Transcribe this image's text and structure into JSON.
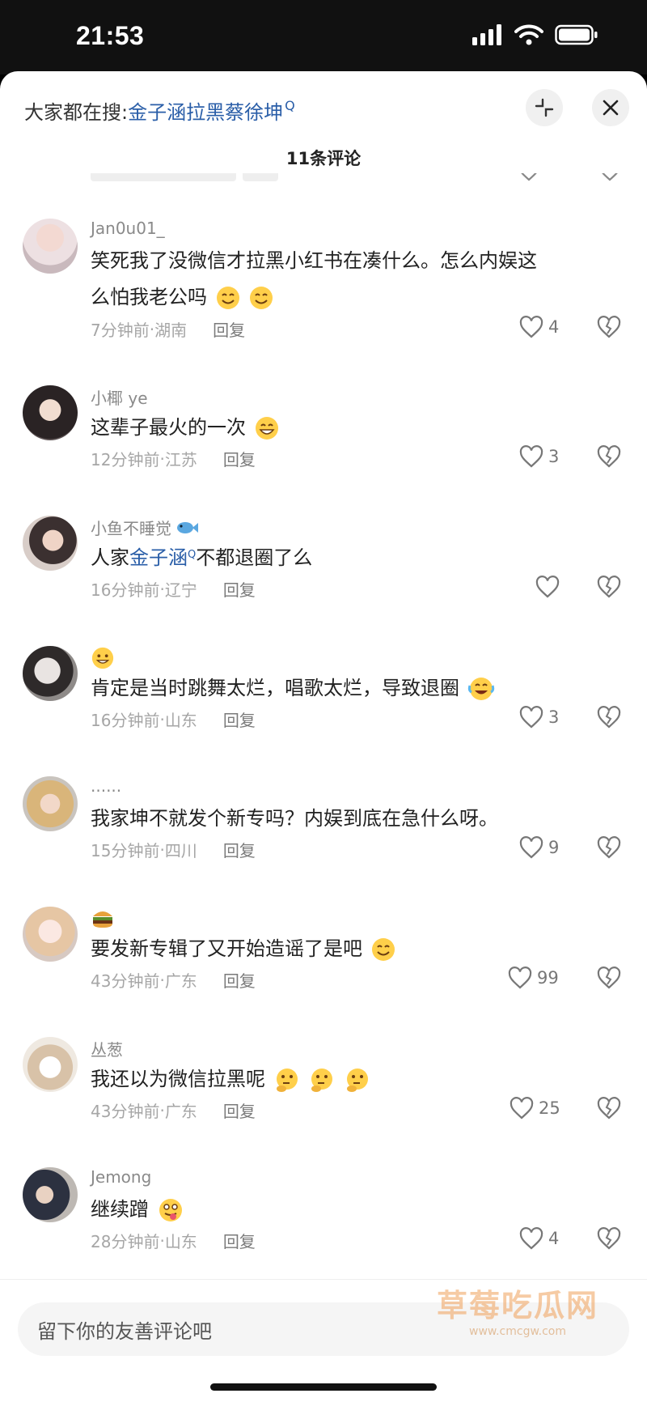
{
  "status": {
    "time": "21:53"
  },
  "header": {
    "search_prefix": "大家都在搜:",
    "search_term": "金子涵拉黑蔡徐坤",
    "search_mark": "Q",
    "title": "11条评论"
  },
  "comments": [
    {
      "user": "Jan0u01_",
      "lines": [
        "笑死我了没微信才拉黑小红书在凑什么。怎么内娱这",
        "么怕我老公吗"
      ],
      "time": "7分钟前",
      "region": "湖南",
      "reply": "回复",
      "likes": "4"
    },
    {
      "user": "小椰 ye",
      "lines": [
        "这辈子最火的一次"
      ],
      "time": "12分钟前",
      "region": "江苏",
      "reply": "回复",
      "likes": "3"
    },
    {
      "user": "小鱼不睡觉",
      "text_before": "人家",
      "highlight": "金子涵",
      "highlight_mark": "Q",
      "text_after": "不都退圈了么",
      "time": "16分钟前",
      "region": "辽宁",
      "reply": "回复",
      "likes": ""
    },
    {
      "user": "",
      "lines": [
        "肯定是当时跳舞太烂，唱歌太烂，导致退圈"
      ],
      "time": "16分钟前",
      "region": "山东",
      "reply": "回复",
      "likes": "3"
    },
    {
      "user": "......",
      "lines": [
        "我家坤不就发个新专吗？内娱到底在急什么呀。"
      ],
      "time": "15分钟前",
      "region": "四川",
      "reply": "回复",
      "likes": "9"
    },
    {
      "user": "",
      "lines": [
        "要发新专辑了又开始造谣了是吧"
      ],
      "time": "43分钟前",
      "region": "广东",
      "reply": "回复",
      "likes": "99"
    },
    {
      "user": "丛葱",
      "lines": [
        "我还以为微信拉黑呢"
      ],
      "time": "43分钟前",
      "region": "广东",
      "reply": "回复",
      "likes": "25"
    },
    {
      "user": "Jemong",
      "lines": [
        "继续蹭"
      ],
      "time": "28分钟前",
      "region": "山东",
      "reply": "回复",
      "likes": "4"
    }
  ],
  "footer": {
    "placeholder": "留下你的友善评论吧"
  },
  "watermark": {
    "title": "草莓吃瓜网",
    "url": "www.cmcgw.com"
  },
  "colors": {
    "link": "#2a5ea8",
    "meta": "#a6a6a6",
    "text": "#222222"
  }
}
